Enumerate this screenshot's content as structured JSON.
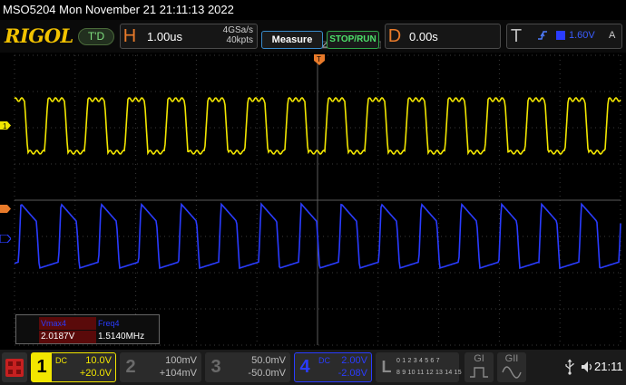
{
  "title": "MSO5204  Mon November 21 21:11:13 2022",
  "toolbar": {
    "brand": "RIGOL",
    "run_state": "T'D",
    "horizontal": {
      "letter": "H",
      "timebase": "1.00us",
      "sample_rate": "4GSa/s",
      "memory_depth": "40kpts"
    },
    "measure_label": "Measure",
    "stop_run_label": "STOP/RUN",
    "delay": {
      "letter": "D",
      "value": "0.00s"
    },
    "trigger": {
      "letter": "T",
      "edge_icon": "rising-edge-icon",
      "level": "1.60V",
      "mode": "A"
    }
  },
  "markers": {
    "ch1": "1",
    "trigger_pos": "T"
  },
  "measurements": {
    "items": [
      {
        "name": "Vmax4",
        "value": "2.0187V"
      },
      {
        "name": "Freq4",
        "value": "1.5140MHz"
      }
    ]
  },
  "channels": [
    {
      "num": "1",
      "coupling": "DC",
      "scale": "10.0V",
      "offset": "+20.0V",
      "color": "#f2e600",
      "enabled": true
    },
    {
      "num": "2",
      "scale": "100mV",
      "offset": "+104mV",
      "enabled": false
    },
    {
      "num": "3",
      "scale": "50.0mV",
      "offset": "-50.0mV",
      "enabled": false
    },
    {
      "num": "4",
      "coupling": "DC",
      "scale": "2.00V",
      "offset": "-2.08V",
      "color": "#2a3cff",
      "enabled": true
    }
  ],
  "logic": {
    "label": "L",
    "row1": "0 1 2 3  4 5 6 7",
    "row2": "8 9 10 11 12 13 14 15"
  },
  "decoders": [
    {
      "label": "GI"
    },
    {
      "label": "GII"
    }
  ],
  "status": {
    "clock": "21:11",
    "usb_icon": "usb-icon",
    "speaker_icon": "speaker-icon"
  },
  "signals": {
    "ch1": {
      "color": "#f2e600",
      "frequency_mhz": 1.514,
      "divisions_per_screen": 10
    },
    "ch4": {
      "color": "#2a3cff",
      "frequency_mhz": 1.514
    }
  }
}
